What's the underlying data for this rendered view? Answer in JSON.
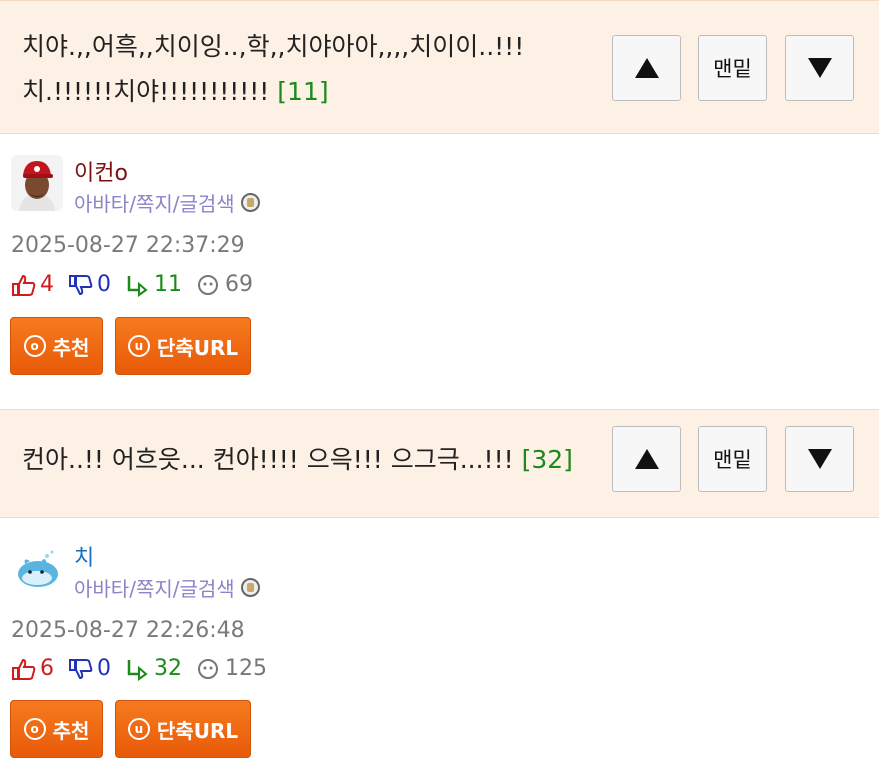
{
  "posts": [
    {
      "title_line1": "치야.,,어흑,,치이잉..,학,,치야아아,,,,치이이..!!!",
      "title_line2": "치.!!!!!!치야!!!!!!!!!!!",
      "reply_count": "[11]",
      "nav": {
        "up": "▲",
        "bottom": "맨밑",
        "down": "▼"
      },
      "username": "이컨o",
      "username_color": "#7a1010",
      "user_links": "아바타/쪽지/글검색",
      "datetime": "2025-08-27 22:37:29",
      "stats": {
        "up": "4",
        "down": "0",
        "replies": "11",
        "views": "69"
      },
      "buttons": {
        "recommend": "추천",
        "short_url": "단축URL"
      },
      "icons": {
        "recommend": "circle-o-icon",
        "short_url": "circle-u-icon"
      }
    },
    {
      "title_line1": "컨아..!! 어흐읏... 컨아!!!! 으윽!!! 으그극...!!!",
      "reply_count": "[32]",
      "nav": {
        "up": "▲",
        "bottom": "맨밑",
        "down": "▼"
      },
      "username": "치",
      "username_color": "#1a6fc4",
      "user_links": "아바타/쪽지/글검색",
      "datetime": "2025-08-27 22:26:48",
      "stats": {
        "up": "6",
        "down": "0",
        "replies": "32",
        "views": "125"
      },
      "buttons": {
        "recommend": "추천",
        "short_url": "단축URL"
      },
      "icons": {
        "recommend": "circle-o-icon",
        "short_url": "circle-u-icon"
      }
    }
  ],
  "colors": {
    "accent_orange": "#ef6a10",
    "title_bg": "#fdf1e6",
    "link_purple": "#8a85c9",
    "up_red": "#d01c1c",
    "down_blue": "#2233bb",
    "reply_green": "#1a8a1a"
  }
}
